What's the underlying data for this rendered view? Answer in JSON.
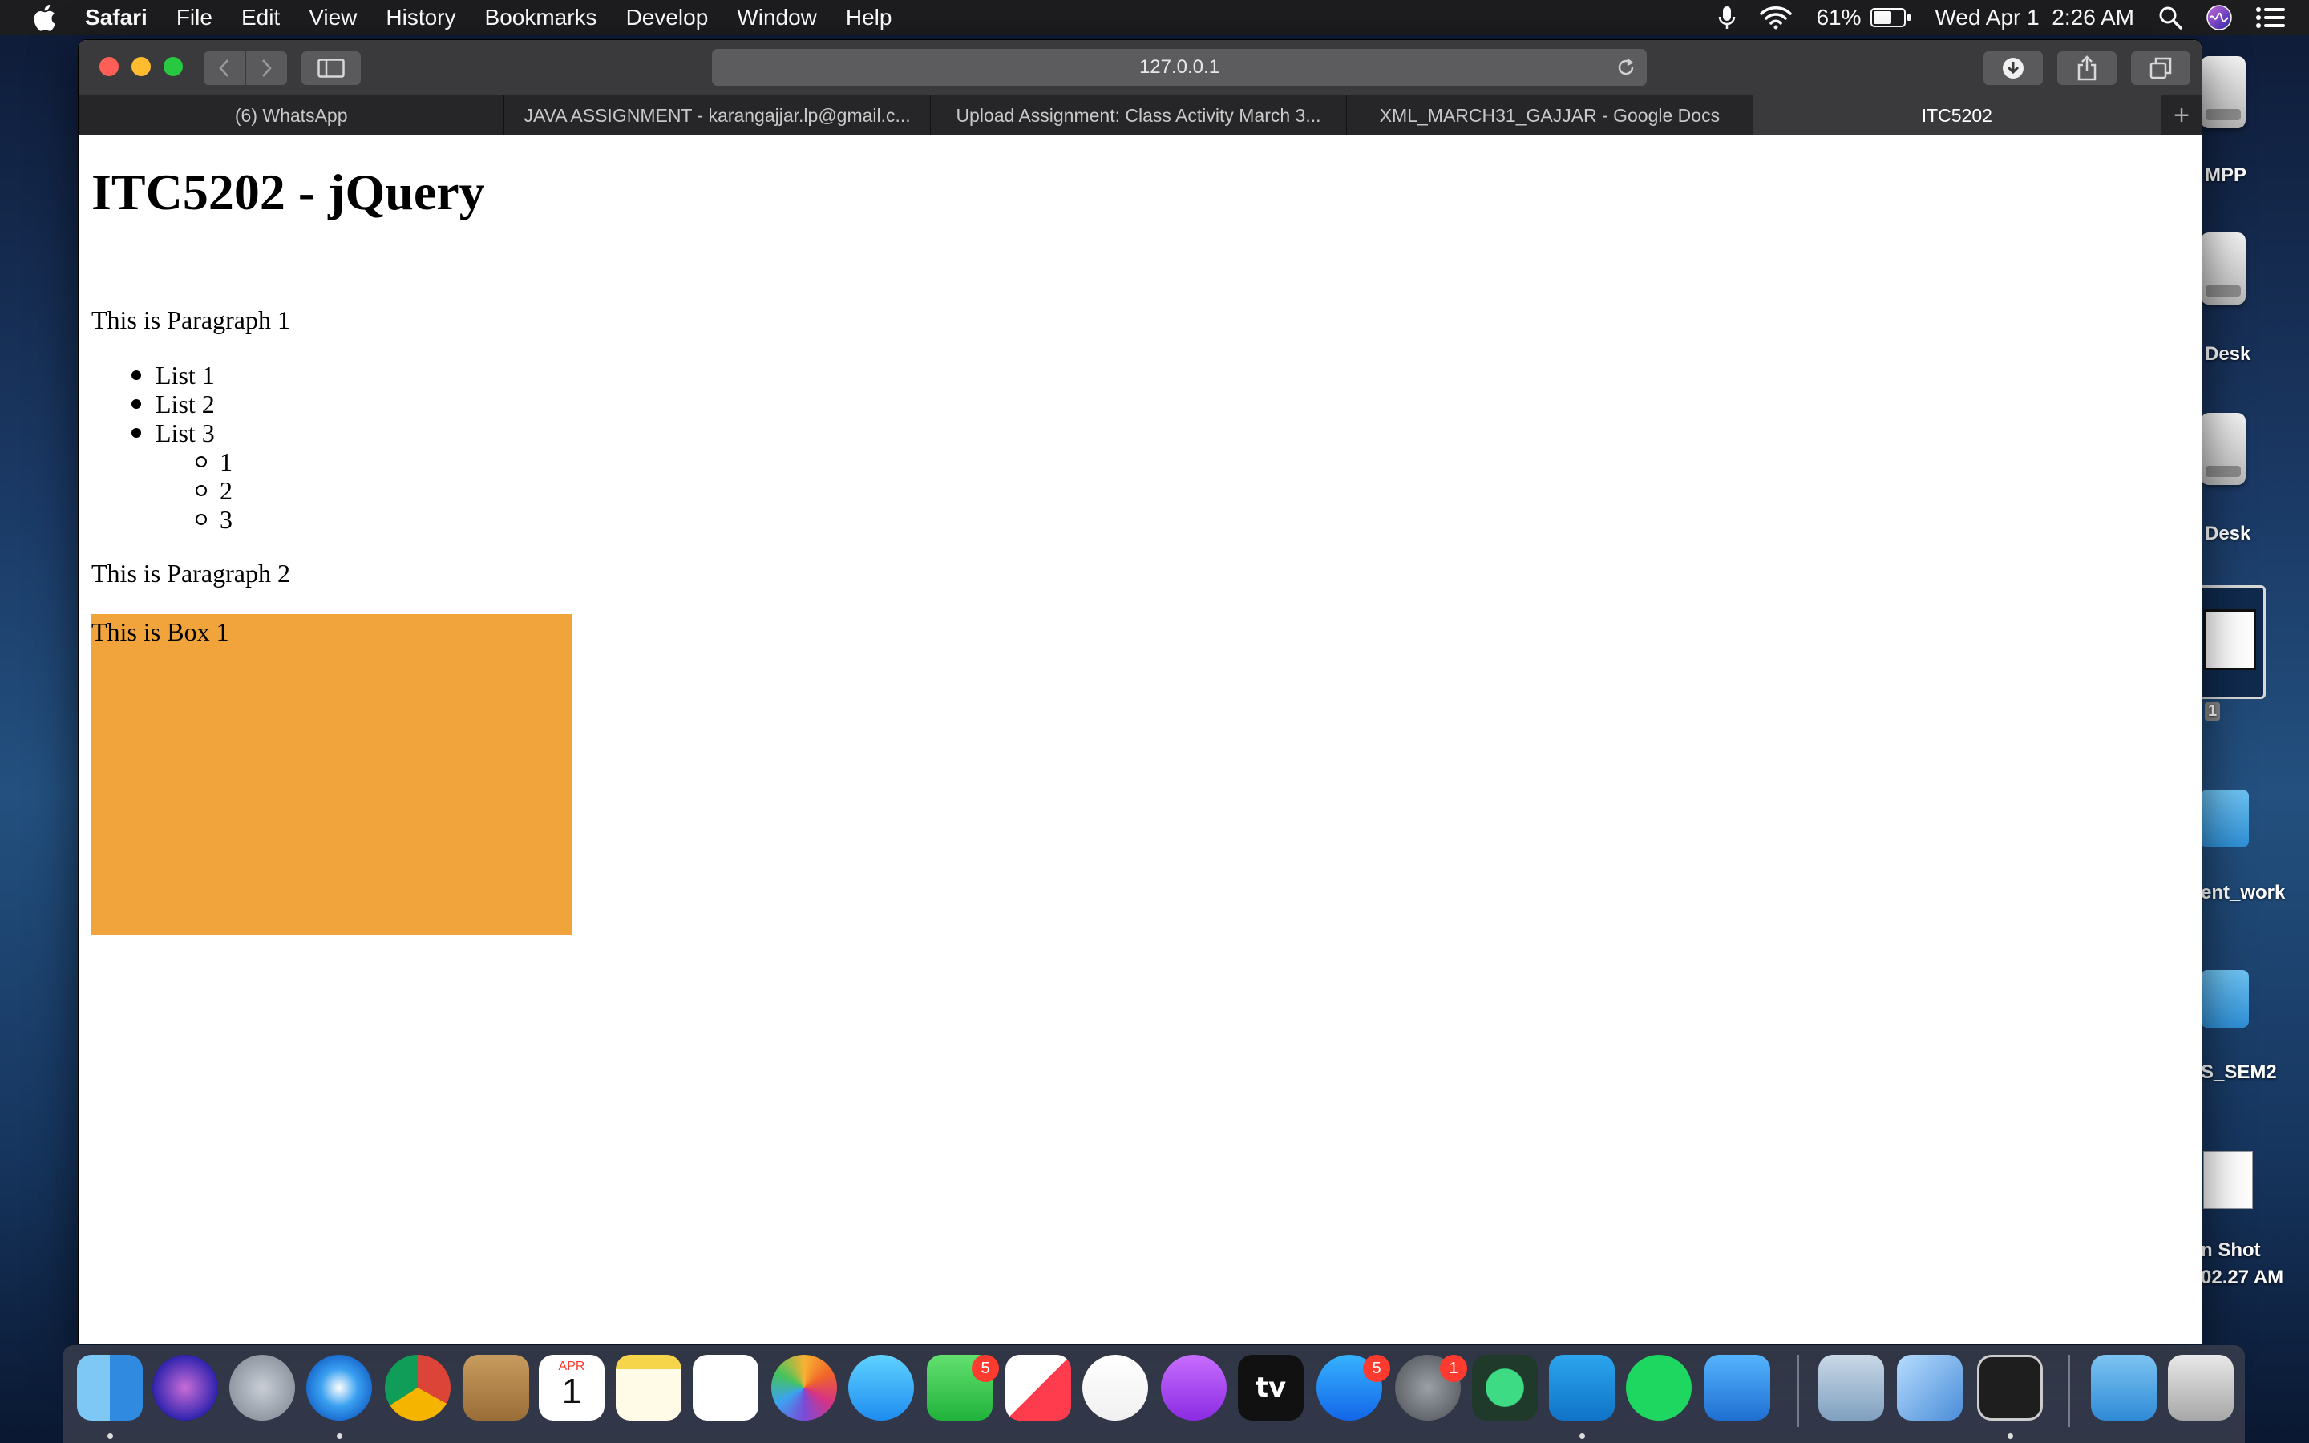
{
  "menubar": {
    "app_name": "Safari",
    "menus": [
      "File",
      "Edit",
      "View",
      "History",
      "Bookmarks",
      "Develop",
      "Window",
      "Help"
    ],
    "battery_percent": "61%",
    "battery_level": 0.61,
    "datetime": "Wed Apr 1  2:26 AM"
  },
  "browser": {
    "address": "127.0.0.1",
    "tabs": [
      {
        "label": "(6) WhatsApp",
        "active": false
      },
      {
        "label": "JAVA ASSIGNMENT - karangajjar.lp@gmail.c...",
        "active": false
      },
      {
        "label": "Upload Assignment: Class Activity March 3...",
        "active": false
      },
      {
        "label": "XML_MARCH31_GAJJAR - Google Docs",
        "active": false
      },
      {
        "label": "ITC5202",
        "active": true
      }
    ],
    "new_tab_symbol": "+"
  },
  "page": {
    "title": "ITC5202 - jQuery",
    "paragraph1": "This is Paragraph 1",
    "list": [
      "List 1",
      "List 2",
      "List 3"
    ],
    "sublist": [
      "1",
      "2",
      "3"
    ],
    "paragraph2": "This is Paragraph 2",
    "box1": "This is Box 1",
    "box_color": "#f1a43c"
  },
  "desktop": {
    "labels": [
      "MPP",
      "Desk",
      "Desk",
      "1",
      "ent_work",
      "S_SEM2",
      "n Shot",
      "02.27 AM"
    ]
  },
  "dock": {
    "apps": [
      {
        "name": "finder-icon"
      },
      {
        "name": "siri-icon"
      },
      {
        "name": "launchpad-icon"
      },
      {
        "name": "safari-icon"
      },
      {
        "name": "chrome-icon"
      },
      {
        "name": "contacts-icon"
      },
      {
        "name": "calendar-icon"
      },
      {
        "name": "notes-icon"
      },
      {
        "name": "reminders-icon"
      },
      {
        "name": "photos-icon"
      },
      {
        "name": "messages-icon"
      },
      {
        "name": "facetime-icon"
      },
      {
        "name": "news-icon"
      },
      {
        "name": "music-icon"
      },
      {
        "name": "podcasts-icon"
      },
      {
        "name": "apple-tv-icon"
      },
      {
        "name": "app-store-icon"
      },
      {
        "name": "system-preferences-icon"
      },
      {
        "name": "android-studio-icon"
      },
      {
        "name": "vscode-icon"
      },
      {
        "name": "spotify-icon"
      },
      {
        "name": "xcode-icon"
      },
      {
        "name": "mail-icon"
      },
      {
        "name": "virtualbox-icon"
      },
      {
        "name": "terminal-icon"
      },
      {
        "name": "downloads-folder-icon"
      },
      {
        "name": "trash-icon"
      }
    ],
    "badges": {
      "facetime": "5",
      "app_store": "5",
      "system_preferences": "1"
    },
    "calendar": {
      "month": "APR",
      "day": "1"
    },
    "appletv_label": "tv"
  }
}
